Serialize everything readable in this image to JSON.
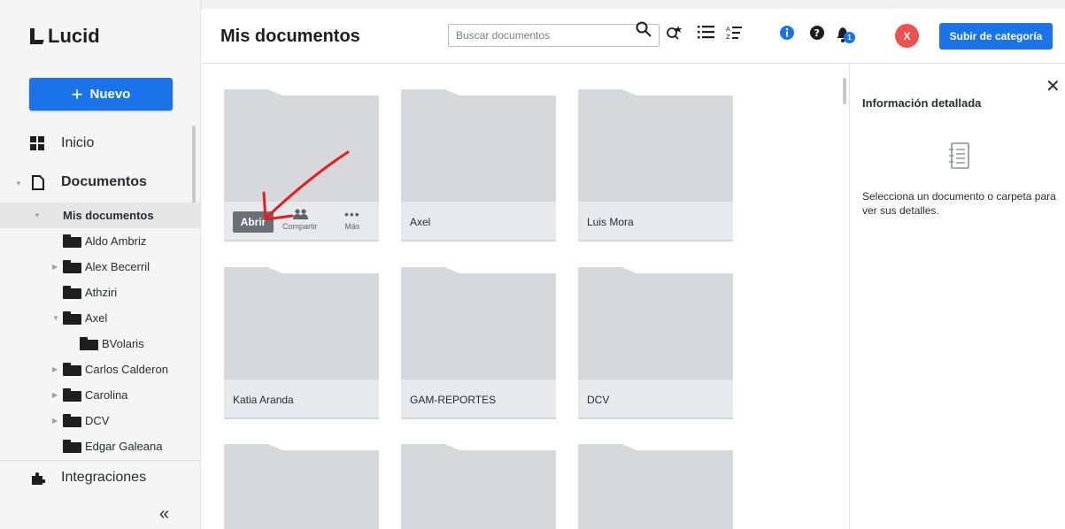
{
  "app": {
    "name": "Lucid"
  },
  "sidebar": {
    "new_button": "Nuevo",
    "nav": {
      "home": "Inicio",
      "documents": "Documentos",
      "integrations": "Integraciones"
    },
    "tree": [
      {
        "label": "Mis documentos",
        "selected": true
      },
      {
        "label": "Aldo Ambriz"
      },
      {
        "label": "Alex Becerril"
      },
      {
        "label": "Athziri"
      },
      {
        "label": "Axel"
      },
      {
        "label": "BVolaris"
      },
      {
        "label": "Carlos Calderon"
      },
      {
        "label": "Carolina"
      },
      {
        "label": "DCV"
      },
      {
        "label": "Edgar Galeana"
      }
    ],
    "collapse_glyph": "«"
  },
  "header": {
    "title": "Mis documentos",
    "search_placeholder": "Buscar documentos",
    "avatar_initial": "X",
    "notification_count": "1",
    "upload_button": "Subir de categoría"
  },
  "grid": {
    "cards": [
      {
        "label": ""
      },
      {
        "label": "Axel"
      },
      {
        "label": "Luis Mora"
      },
      {
        "label": "Katia Aranda"
      },
      {
        "label": "GAM-REPORTES"
      },
      {
        "label": "DCV"
      },
      {
        "label": ""
      },
      {
        "label": ""
      },
      {
        "label": ""
      }
    ],
    "hover_actions": {
      "open": "Abrir",
      "share": "Compartir",
      "more": "Más"
    }
  },
  "panel": {
    "title": "Información detallada",
    "empty_text": "Selecciona un documento o carpeta para ver sus detalles."
  },
  "colors": {
    "primary": "#1a73e8",
    "avatar": "#ee4f4f",
    "annotation": "#e02020"
  }
}
